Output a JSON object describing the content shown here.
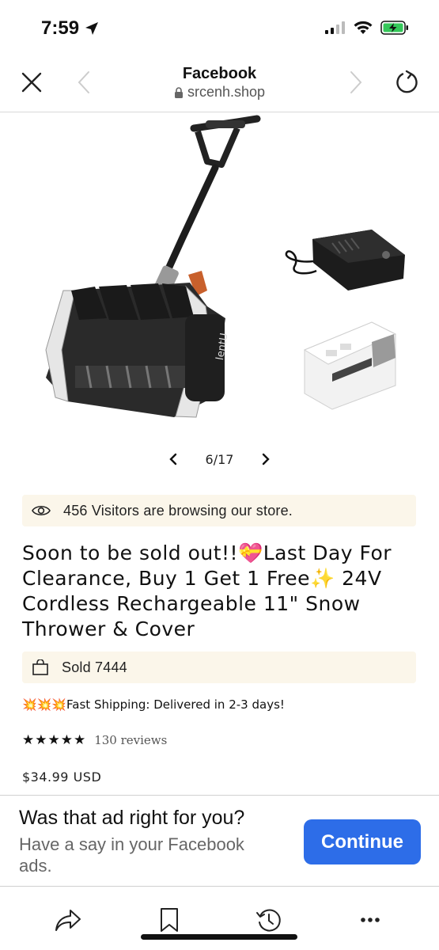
{
  "status_bar": {
    "time": "7:59"
  },
  "browser": {
    "title": "Facebook",
    "url": "srcenh.shop"
  },
  "gallery": {
    "counter": "6/17",
    "brand_text": "lentU"
  },
  "visitors": {
    "text": "456 Visitors are browsing our store."
  },
  "product": {
    "title": "Soon to be sold out!!💝Last Day For Clearance, Buy 1 Get 1 Free✨ 24V Cordless Rechargeable 11\" Snow Thrower & Cover",
    "sold_text": "Sold 7444",
    "shipping_emoji": "💥💥💥",
    "shipping_text": "Fast Shipping: Delivered in 2-3 days!",
    "stars": "★★★★★",
    "rating": 5,
    "reviews": "130 reviews",
    "price": "$34.99 USD"
  },
  "feedback": {
    "question": "Was that ad right for you?",
    "subtitle": "Have a say in your Facebook ads.",
    "button": "Continue"
  },
  "colors": {
    "accent": "#2d6de8",
    "info_bg": "#fbf6ea",
    "battery": "#34c759"
  },
  "icons": {
    "close": "close-icon",
    "back": "chevron-left-icon",
    "forward": "chevron-right-icon",
    "reload": "reload-icon",
    "lock": "lock-icon",
    "eye": "eye-icon",
    "bag": "shopping-bag-icon",
    "share": "share-icon",
    "bookmark": "bookmark-icon",
    "history": "history-icon",
    "more": "more-icon"
  }
}
